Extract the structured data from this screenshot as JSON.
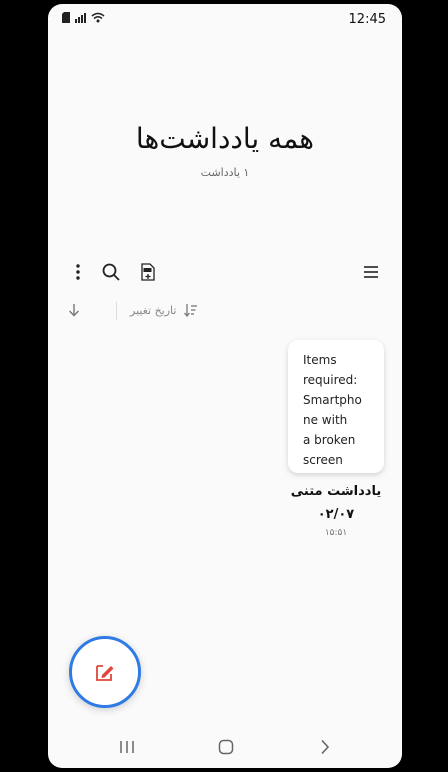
{
  "status_bar": {
    "time": "12:45"
  },
  "header": {
    "title": "همه یادداشت‌ها",
    "subtitle": "۱ یادداشت"
  },
  "sort": {
    "label": "تاریخ تغییر"
  },
  "notes": [
    {
      "preview": "Items\nrequired:\nSmartpho\nne with\na broken\nscreen",
      "title": "یادداشت متنی",
      "date": "۰۲/۰۷",
      "time": "۱۵:۵۱"
    }
  ],
  "icons": {
    "more": "more-vertical-icon",
    "search": "search-icon",
    "pdf": "pdf-import-icon",
    "menu": "hamburger-menu-icon",
    "sort_direction": "arrow-down-icon",
    "sort_order": "sort-icon",
    "compose": "compose-note-icon"
  },
  "colors": {
    "accent": "#2f7be6",
    "compose_icon": "#e0463a",
    "background": "#fafafa"
  }
}
